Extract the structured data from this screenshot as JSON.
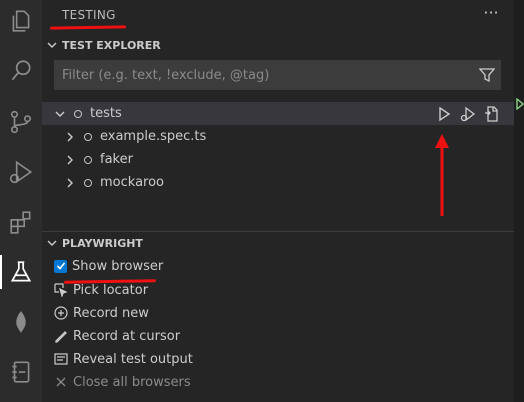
{
  "colors": {
    "background": "#252526",
    "activity_bar": "#2c2c2c",
    "accent": "#0078d4",
    "annotation_red": "#e11111",
    "run_green": "#89d185"
  },
  "activity_bar": {
    "items": [
      {
        "name": "explorer",
        "icon": "files-icon"
      },
      {
        "name": "search",
        "icon": "search-icon"
      },
      {
        "name": "source-control",
        "icon": "source-control-icon"
      },
      {
        "name": "run-debug",
        "icon": "run-debug-icon"
      },
      {
        "name": "extensions",
        "icon": "extensions-icon"
      },
      {
        "name": "testing",
        "icon": "flask-icon",
        "active": true
      },
      {
        "name": "mongodb",
        "icon": "leaf-icon"
      },
      {
        "name": "notebook",
        "icon": "notebook-icon"
      }
    ]
  },
  "sidebar": {
    "title": "TESTING",
    "more_label": "···",
    "test_explorer": {
      "header": "TEST EXPLORER",
      "filter_placeholder": "Filter (e.g. text, !exclude, @tag)",
      "filter_value": "",
      "tree": [
        {
          "label": "tests",
          "expanded": true,
          "level": 0
        },
        {
          "label": "example.spec.ts",
          "expanded": false,
          "level": 1
        },
        {
          "label": "faker",
          "expanded": false,
          "level": 1
        },
        {
          "label": "mockaroo",
          "expanded": false,
          "level": 1
        }
      ],
      "row_actions": [
        "run-icon",
        "debug-icon",
        "go-to-file-icon"
      ]
    },
    "playwright": {
      "header": "PLAYWRIGHT",
      "show_browser": {
        "label": "Show browser",
        "checked": true
      },
      "items": [
        {
          "label": "Pick locator",
          "icon": "pick-locator-icon",
          "enabled": true
        },
        {
          "label": "Record new",
          "icon": "record-new-icon",
          "enabled": true
        },
        {
          "label": "Record at cursor",
          "icon": "record-cursor-icon",
          "enabled": true
        },
        {
          "label": "Reveal test output",
          "icon": "output-icon",
          "enabled": true
        },
        {
          "label": "Close all browsers",
          "icon": "close-icon",
          "enabled": false
        }
      ]
    }
  }
}
